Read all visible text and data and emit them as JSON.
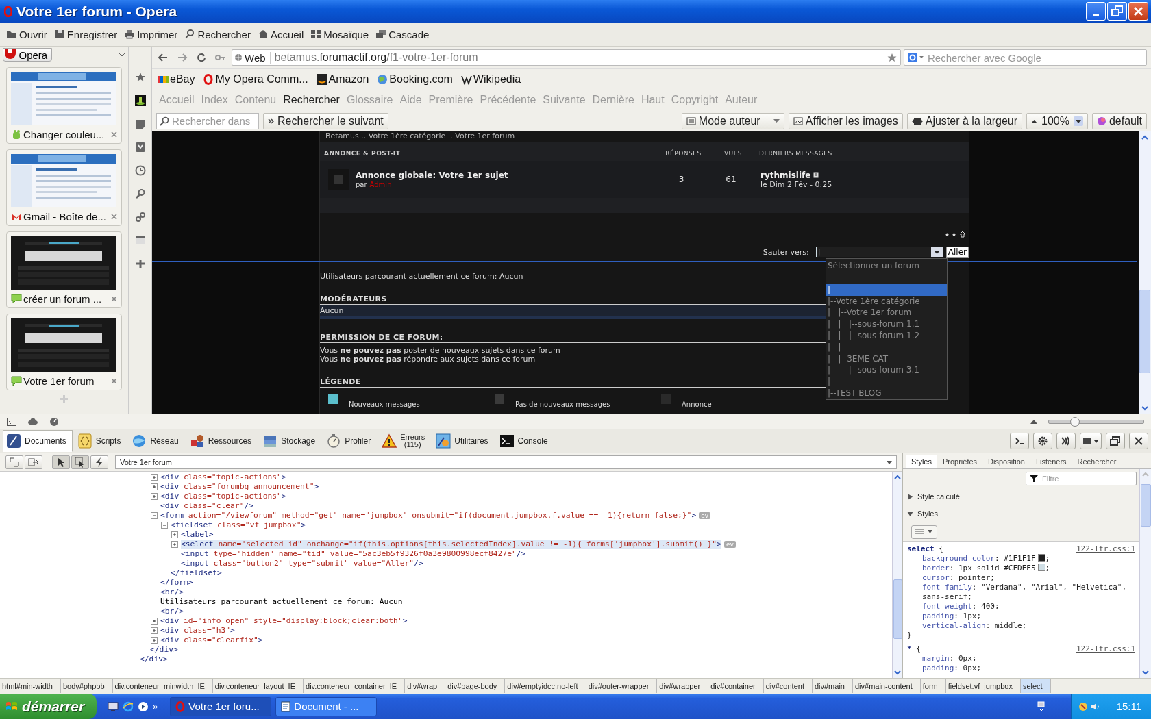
{
  "window": {
    "title": "Votre 1er forum - Opera"
  },
  "toolbar": [
    "Ouvrir",
    "Enregistrer",
    "Imprimer",
    "Rechercher",
    "Accueil",
    "Mosaïque",
    "Cascade"
  ],
  "panel": {
    "menu_label": "Opera",
    "tabs": [
      {
        "title": "Changer couleu..."
      },
      {
        "title": "Gmail - Boîte de..."
      },
      {
        "title": "créer un forum ..."
      },
      {
        "title": "Votre 1er forum"
      }
    ]
  },
  "address_bar": {
    "badge": "Web",
    "url": [
      {
        "text": "betamus.",
        "strong": false
      },
      {
        "text": "forumactif.org",
        "strong": true
      },
      {
        "text": "/f1-votre-1er-forum",
        "strong": false
      }
    ],
    "search_placeholder": "Rechercher avec Google"
  },
  "bookmarks": [
    "eBay",
    "My Opera Comm...",
    "Amazon",
    "Booking.com",
    "Wikipedia"
  ],
  "nav_links": [
    {
      "label": "Accueil",
      "disabled": true
    },
    {
      "label": "Index",
      "disabled": true
    },
    {
      "label": "Contenu",
      "disabled": true
    },
    {
      "label": "Rechercher",
      "disabled": false
    },
    {
      "label": "Glossaire",
      "disabled": true
    },
    {
      "label": "Aide",
      "disabled": true
    },
    {
      "label": "Première",
      "disabled": true
    },
    {
      "label": "Précédente",
      "disabled": true
    },
    {
      "label": "Suivante",
      "disabled": true
    },
    {
      "label": "Dernière",
      "disabled": true
    },
    {
      "label": "Haut",
      "disabled": true
    },
    {
      "label": "Copyright",
      "disabled": true
    },
    {
      "label": "Auteur",
      "disabled": true
    }
  ],
  "find_bar": {
    "placeholder": "Rechercher dans",
    "next": "Rechercher le suivant",
    "mode": "Mode auteur",
    "images": "Afficher les images",
    "fit": "Ajuster à la largeur",
    "zoom": "100%",
    "style": "default"
  },
  "forum": {
    "breadcrumb": "Betamus .. Votre 1ère catégorie .. Votre 1er forum",
    "header": {
      "title": "ANNONCE & POST-IT",
      "replies": "RÉPONSES",
      "views": "VUES",
      "last": "DERNIERS MESSAGES"
    },
    "topics": [
      {
        "title": "Annonce globale: Votre 1er sujet",
        "by": "par",
        "author": "Admin",
        "replies": "3",
        "views": "61",
        "last_user": "rythmislife",
        "last_date": "le Dim 2 Fév - 0:25"
      }
    ],
    "jump_label": "Sauter vers:",
    "go_button": "Aller",
    "options": [
      {
        "text": "Sélectionner un forum",
        "kind": "heading",
        "selected": false
      },
      {
        "text": "|",
        "kind": "option",
        "selected": true
      },
      {
        "text": "|--Votre 1ère catégorie",
        "kind": "option",
        "selected": false
      },
      {
        "text": "|   |--Votre 1er forum",
        "kind": "option",
        "selected": false
      },
      {
        "text": "|   |   |--sous-forum 1.1",
        "kind": "option",
        "selected": false
      },
      {
        "text": "|   |   |--sous-forum 1.2",
        "kind": "option",
        "selected": false
      },
      {
        "text": "|   |",
        "kind": "option",
        "selected": false
      },
      {
        "text": "|   |--3EME CAT",
        "kind": "option",
        "selected": false
      },
      {
        "text": "|       |--sous-forum 3.1",
        "kind": "option",
        "selected": false
      },
      {
        "text": "|",
        "kind": "option",
        "selected": false
      },
      {
        "text": "|--TEST BLOG",
        "kind": "option",
        "selected": false
      }
    ],
    "users_online": "Utilisateurs parcourant actuellement ce forum: Aucun",
    "moderators": {
      "title": "MODÉRATEURS",
      "value": "Aucun"
    },
    "permissions": {
      "title": "PERMISSION DE CE FORUM:",
      "lines": [
        "Vous **ne pouvez pas** poster de nouveaux sujets dans ce forum",
        "Vous **ne pouvez pas** répondre aux sujets dans ce forum"
      ]
    },
    "legend": {
      "title": "LÉGENDE",
      "items": [
        {
          "label": "Nouveaux messages",
          "color": "#5bbfcc"
        },
        {
          "label": "Pas de nouveaux messages",
          "color": "#3a3a3a"
        },
        {
          "label": "Annonce",
          "color": "#2a2a2a"
        }
      ]
    }
  },
  "devtools": {
    "zoom_slider": {
      "level": 0.27
    },
    "tabs": [
      {
        "label": "Documents",
        "selected": true
      },
      {
        "label": "Scripts",
        "selected": false
      },
      {
        "label": "Réseau",
        "selected": false
      },
      {
        "label": "Ressources",
        "selected": false
      },
      {
        "label": "Stockage",
        "selected": false
      },
      {
        "label": "Profiler",
        "selected": false
      },
      {
        "label": "Erreurs",
        "count": "(115)",
        "selected": false
      },
      {
        "label": "Utilitaires",
        "selected": false
      },
      {
        "label": "Console",
        "selected": false
      }
    ],
    "document": "Votre 1er forum",
    "dom_tree": [
      {
        "close": [
          {
            "kind": "tag",
            "text": "</div>"
          }
        ],
        "children": [
          {
            "close": [
              {
                "kind": "tag",
                "text": "</div>"
              }
            ],
            "children": [
              {
                "kind": "collapsed",
                "selected": false,
                "parts": [
                  {
                    "kind": "tag",
                    "text": "<div"
                  },
                  {
                    "kind": "attr",
                    "text": " class="
                  },
                  {
                    "kind": "value",
                    "text": "\"topic-actions\""
                  },
                  {
                    "kind": "tag",
                    "text": ">"
                  }
                ]
              },
              {
                "kind": "collapsed",
                "selected": false,
                "parts": [
                  {
                    "kind": "tag",
                    "text": "<div"
                  },
                  {
                    "kind": "attr",
                    "text": " class="
                  },
                  {
                    "kind": "value",
                    "text": "\"forumbg announcement\""
                  },
                  {
                    "kind": "tag",
                    "text": ">"
                  }
                ]
              },
              {
                "kind": "collapsed",
                "selected": false,
                "parts": [
                  {
                    "kind": "tag",
                    "text": "<div"
                  },
                  {
                    "kind": "attr",
                    "text": " class="
                  },
                  {
                    "kind": "value",
                    "text": "\"topic-actions\""
                  },
                  {
                    "kind": "tag",
                    "text": ">"
                  }
                ]
              },
              {
                "kind": "leaf",
                "selected": false,
                "parts": [
                  {
                    "kind": "tag",
                    "text": "<div"
                  },
                  {
                    "kind": "attr",
                    "text": " class="
                  },
                  {
                    "kind": "value",
                    "text": "\"clear\""
                  },
                  {
                    "kind": "tag",
                    "text": "/>"
                  }
                ]
              },
              {
                "kind": "expanded",
                "selected": false,
                "badge": "ev",
                "parts": [
                  {
                    "kind": "tag",
                    "text": "<form"
                  },
                  {
                    "kind": "attr",
                    "text": " action="
                  },
                  {
                    "kind": "value",
                    "text": "\"/viewforum\""
                  },
                  {
                    "kind": "attr",
                    "text": " method="
                  },
                  {
                    "kind": "value",
                    "text": "\"get\""
                  },
                  {
                    "kind": "attr",
                    "text": " name="
                  },
                  {
                    "kind": "value",
                    "text": "\"jumpbox\""
                  },
                  {
                    "kind": "attr",
                    "text": " onsubmit="
                  },
                  {
                    "kind": "value",
                    "text": "\"if(document.jumpbox.f.value == -1){return false;}\""
                  },
                  {
                    "kind": "tag",
                    "text": ">"
                  }
                ],
                "close": [
                  {
                    "kind": "tag",
                    "text": "</form>"
                  }
                ],
                "children": [
                  {
                    "kind": "expanded",
                    "selected": false,
                    "parts": [
                      {
                        "kind": "tag",
                        "text": "<fieldset"
                      },
                      {
                        "kind": "attr",
                        "text": " class="
                      },
                      {
                        "kind": "value",
                        "text": "\"vf_jumpbox\""
                      },
                      {
                        "kind": "tag",
                        "text": ">"
                      }
                    ],
                    "close": [
                      {
                        "kind": "tag",
                        "text": "</fieldset>"
                      }
                    ],
                    "children": [
                      {
                        "kind": "collapsed",
                        "selected": false,
                        "parts": [
                          {
                            "kind": "tag",
                            "text": "<label>"
                          }
                        ]
                      },
                      {
                        "kind": "collapsed",
                        "selected": true,
                        "badge": "ev",
                        "parts": [
                          {
                            "kind": "tag",
                            "text": "<select"
                          },
                          {
                            "kind": "attr",
                            "text": " name="
                          },
                          {
                            "kind": "value",
                            "text": "\"selected_id\""
                          },
                          {
                            "kind": "attr",
                            "text": " onchange="
                          },
                          {
                            "kind": "value",
                            "text": "\"if(this.options[this.selectedIndex].value != -1){ forms['jumpbox'].submit() }\""
                          },
                          {
                            "kind": "tag",
                            "text": ">"
                          }
                        ]
                      },
                      {
                        "kind": "leaf",
                        "selected": false,
                        "parts": [
                          {
                            "kind": "tag",
                            "text": "<input"
                          },
                          {
                            "kind": "attr",
                            "text": " type="
                          },
                          {
                            "kind": "value",
                            "text": "\"hidden\""
                          },
                          {
                            "kind": "attr",
                            "text": " name="
                          },
                          {
                            "kind": "value",
                            "text": "\"tid\""
                          },
                          {
                            "kind": "attr",
                            "text": " value="
                          },
                          {
                            "kind": "value",
                            "text": "\"5ac3eb5f9326f0a3e9800998ecf8427e\""
                          },
                          {
                            "kind": "tag",
                            "text": "/>"
                          }
                        ]
                      },
                      {
                        "kind": "leaf",
                        "selected": false,
                        "parts": [
                          {
                            "kind": "tag",
                            "text": "<input"
                          },
                          {
                            "kind": "attr",
                            "text": " class="
                          },
                          {
                            "kind": "value",
                            "text": "\"button2\""
                          },
                          {
                            "kind": "attr",
                            "text": " type="
                          },
                          {
                            "kind": "value",
                            "text": "\"submit\""
                          },
                          {
                            "kind": "attr",
                            "text": " value="
                          },
                          {
                            "kind": "value",
                            "text": "\"Aller\""
                          },
                          {
                            "kind": "tag",
                            "text": "/>"
                          }
                        ]
                      }
                    ]
                  }
                ]
              },
              {
                "kind": "leaf",
                "selected": false,
                "parts": [
                  {
                    "kind": "tag",
                    "text": "<br/>"
                  }
                ]
              },
              {
                "kind": "leaf",
                "selected": false,
                "parts": [
                  {
                    "kind": "text",
                    "text": "Utilisateurs parcourant actuellement ce forum: Aucun"
                  }
                ]
              },
              {
                "kind": "leaf",
                "selected": false,
                "parts": [
                  {
                    "kind": "tag",
                    "text": "<br/>"
                  }
                ]
              },
              {
                "kind": "collapsed",
                "selected": false,
                "parts": [
                  {
                    "kind": "tag",
                    "text": "<div"
                  },
                  {
                    "kind": "attr",
                    "text": " id="
                  },
                  {
                    "kind": "value",
                    "text": "\"info_open\""
                  },
                  {
                    "kind": "attr",
                    "text": " style="
                  },
                  {
                    "kind": "value",
                    "text": "\"display:block;clear:both\""
                  },
                  {
                    "kind": "tag",
                    "text": ">"
                  }
                ]
              },
              {
                "kind": "collapsed",
                "selected": false,
                "parts": [
                  {
                    "kind": "tag",
                    "text": "<div"
                  },
                  {
                    "kind": "attr",
                    "text": " class="
                  },
                  {
                    "kind": "value",
                    "text": "\"h3\""
                  },
                  {
                    "kind": "tag",
                    "text": ">"
                  }
                ]
              },
              {
                "kind": "collapsed",
                "selected": false,
                "parts": [
                  {
                    "kind": "tag",
                    "text": "<div"
                  },
                  {
                    "kind": "attr",
                    "text": " class="
                  },
                  {
                    "kind": "value",
                    "text": "\"clearfix\""
                  },
                  {
                    "kind": "tag",
                    "text": ">"
                  }
                ]
              }
            ]
          }
        ]
      }
    ],
    "styles_panel": {
      "tabs": [
        {
          "label": "Styles",
          "selected": true
        },
        {
          "label": "Propriétés",
          "selected": false
        },
        {
          "label": "Disposition",
          "selected": false
        },
        {
          "label": "Listeners",
          "selected": false
        },
        {
          "label": "Rechercher",
          "selected": false
        }
      ],
      "filter_placeholder": "Filtre",
      "sections": [
        {
          "label": "Style calculé",
          "expanded": false
        },
        {
          "label": "Styles",
          "expanded": true
        }
      ],
      "rules": [
        {
          "selector": "select",
          "brace": "{",
          "source": "122-ltr.css:1",
          "end": "}",
          "declarations": [
            {
              "property": "background-color",
              "value": ": #1F1F1F",
              "color": "#1f1f1f",
              "tail": ";",
              "overridden": false
            },
            {
              "property": "border",
              "value": ": 1px solid #CFDEE5",
              "color": "#cfdee5",
              "tail": ";",
              "overridden": false
            },
            {
              "property": "cursor",
              "value": ": pointer",
              "tail": ";",
              "overridden": false
            },
            {
              "property": "font-family",
              "value": ": \"Verdana\", \"Arial\", \"Helvetica\", sans-serif",
              "tail": ";",
              "overridden": false
            },
            {
              "property": "font-weight",
              "value": ": 400",
              "tail": ";",
              "overridden": false
            },
            {
              "property": "padding",
              "value": ": 1px",
              "tail": ";",
              "overridden": false
            },
            {
              "property": "vertical-align",
              "value": ": middle",
              "tail": ";",
              "overridden": false
            }
          ]
        },
        {
          "selector": "*",
          "brace": "{",
          "source": "122-ltr.css:1",
          "declarations": [
            {
              "property": "margin",
              "value": ": 0px",
              "tail": ";",
              "overridden": false
            },
            {
              "property": "padding",
              "value": ": 0px",
              "tail": ";",
              "overridden": true
            }
          ]
        }
      ]
    },
    "breadcrumb": [
      {
        "label": "html#min-width",
        "selected": false
      },
      {
        "label": "body#phpbb",
        "selected": false
      },
      {
        "label": "div.conteneur_minwidth_IE",
        "selected": false
      },
      {
        "label": "div.conteneur_layout_IE",
        "selected": false
      },
      {
        "label": "div.conteneur_container_IE",
        "selected": false
      },
      {
        "label": "div#wrap",
        "selected": false
      },
      {
        "label": "div#page-body",
        "selected": false
      },
      {
        "label": "div#emptyidcc.no-left",
        "selected": false
      },
      {
        "label": "div#outer-wrapper",
        "selected": false
      },
      {
        "label": "div#wrapper",
        "selected": false
      },
      {
        "label": "div#container",
        "selected": false
      },
      {
        "label": "div#content",
        "selected": false
      },
      {
        "label": "div#main",
        "selected": false
      },
      {
        "label": "div#main-content",
        "selected": false
      },
      {
        "label": "form",
        "selected": false
      },
      {
        "label": "fieldset.vf_jumpbox",
        "selected": false
      },
      {
        "label": "select",
        "selected": true
      }
    ]
  },
  "taskbar": {
    "start": "démarrer",
    "more": "»",
    "tasks": [
      "Votre 1er foru...",
      "Document - ..."
    ],
    "clock": "15:11"
  }
}
